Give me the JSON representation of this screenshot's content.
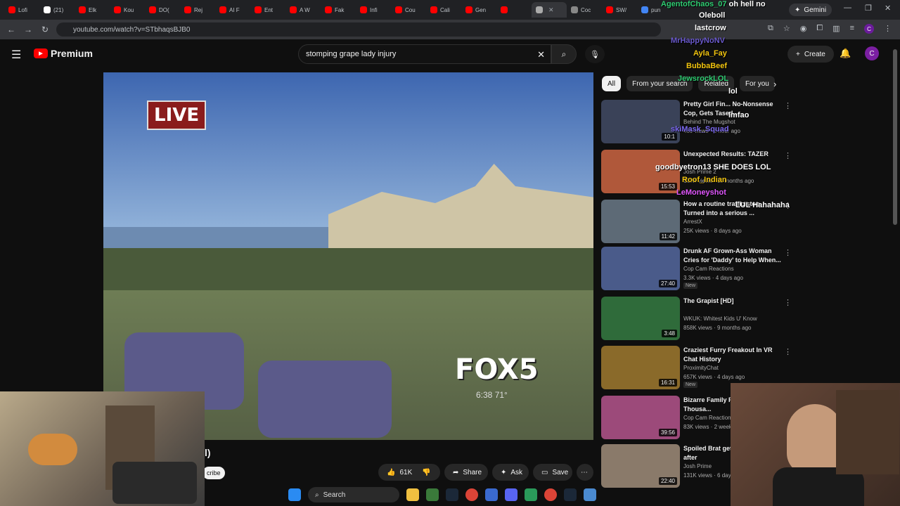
{
  "browser": {
    "tabs": [
      "Lofi",
      "(21)",
      "Elk",
      "Kou",
      "DO(",
      "Rej",
      "AI F",
      "Ent",
      "A W",
      "Fak",
      "Infi",
      "Cou",
      "Cali",
      "Gen",
      "",
      "",
      "Coc",
      "SW/",
      "pun"
    ],
    "gemini_label": "Gemini",
    "url": "youtube.com/watch?v=STbhaqsBJB0",
    "profile_initial": "C"
  },
  "youtube": {
    "logo_text": "Premium",
    "search_query": "stomping grape lady injury",
    "create_label": "Create",
    "avatar_initial": "C"
  },
  "video": {
    "live_badge": "LIVE",
    "station_logo": "FOX5",
    "station_time": "6:38  71°",
    "title_fragment": "l)",
    "subscribe_fragment": "cribe",
    "like_count": "61K",
    "share_label": "Share",
    "ask_label": "Ask",
    "save_label": "Save"
  },
  "filter_chips": [
    "All",
    "From your search",
    "Related",
    "For you"
  ],
  "recommendations": [
    {
      "title": "Pretty Girl Fin... No-Nonsense Cop, Gets Tased ...",
      "channel": "Behind The Mugshot",
      "meta": "489 views · 1 hour ago",
      "duration": "10:1",
      "is_new": false,
      "thumb_color": "#3a4258"
    },
    {
      "title": "Unexpected Results: TAZER",
      "channel": "Josh Prime 2",
      "meta": "223K views · 11 months ago",
      "duration": "15:53",
      "is_new": false,
      "thumb_color": "#b0583a"
    },
    {
      "title": "How a routine traffic stop Turned into a serious ...",
      "channel": "ArrestX",
      "meta": "25K views · 8 days ago",
      "duration": "11:42",
      "is_new": false,
      "thumb_color": "#5d6a76"
    },
    {
      "title": "Drunk AF Grown-Ass Woman Cries for 'Daddy' to Help When...",
      "channel": "Cop Cam Reactions",
      "meta": "3.3K views · 4 days ago",
      "duration": "27:40",
      "is_new": true,
      "thumb_color": "#4a5b8a"
    },
    {
      "title": "The Grapist [HD]",
      "channel": "WKUK: Whitest Kids U' Know",
      "meta": "858K views · 9 months ago",
      "duration": "3:48",
      "is_new": false,
      "thumb_color": "#2f6b3a"
    },
    {
      "title": "Craziest Furry Freakout In VR Chat History",
      "channel": "ProximityChat",
      "meta": "657K views · 4 days ago",
      "duration": "16:31",
      "is_new": true,
      "thumb_color": "#8a6a2a"
    },
    {
      "title": "Bizarre Family F... Front of Thousa...",
      "channel": "Cop Cam Reaction",
      "meta": "83K views · 2 week",
      "duration": "39:56",
      "is_new": false,
      "thumb_color": "#9c4a7a"
    },
    {
      "title": "Spoiled Brat get... SECONDS after",
      "channel": "Josh Prime",
      "meta": "131K views · 6 day",
      "duration": "22:40",
      "is_new": false,
      "thumb_color": "#8a7a6a"
    }
  ],
  "recommendation_new_label": "New",
  "chat_overlay": [
    {
      "user": "AgentofChaos_07",
      "text": "oh hell no",
      "color": "#2ecc71"
    },
    {
      "user": "Oleboll",
      "text": "",
      "color": "#ffffff"
    },
    {
      "user": "lastcrow",
      "text": "",
      "color": "#ffffff"
    },
    {
      "user": "MrHappyNoNV",
      "text": "",
      "color": "#6a5acd"
    },
    {
      "user": "Ayla_Fay",
      "text": "",
      "color": "#f1c40f"
    },
    {
      "user": "BubbaBeef",
      "text": "",
      "color": "#f1c40f"
    },
    {
      "user": "JewsrockLOL",
      "text": "",
      "color": "#2ecc71"
    },
    {
      "user": "",
      "text": "lol",
      "color": "#ffffff"
    },
    {
      "user": "",
      "text": "lmfao",
      "color": "#ffffff"
    },
    {
      "user": "skiMask_Squad",
      "text": "",
      "color": "#7b68ee"
    },
    {
      "user": "goodbyetron13",
      "text": "SHE DOES LOL",
      "color": "#ffffff"
    },
    {
      "user": "Roof_Indian",
      "text": "",
      "color": "#f1c40f"
    },
    {
      "user": "LeMoneyshot",
      "text": "",
      "color": "#e056fd"
    },
    {
      "user": "",
      "text": "LUL Hahahaha",
      "color": "#ffffff"
    }
  ],
  "taskbar": {
    "search_label": "Search"
  }
}
